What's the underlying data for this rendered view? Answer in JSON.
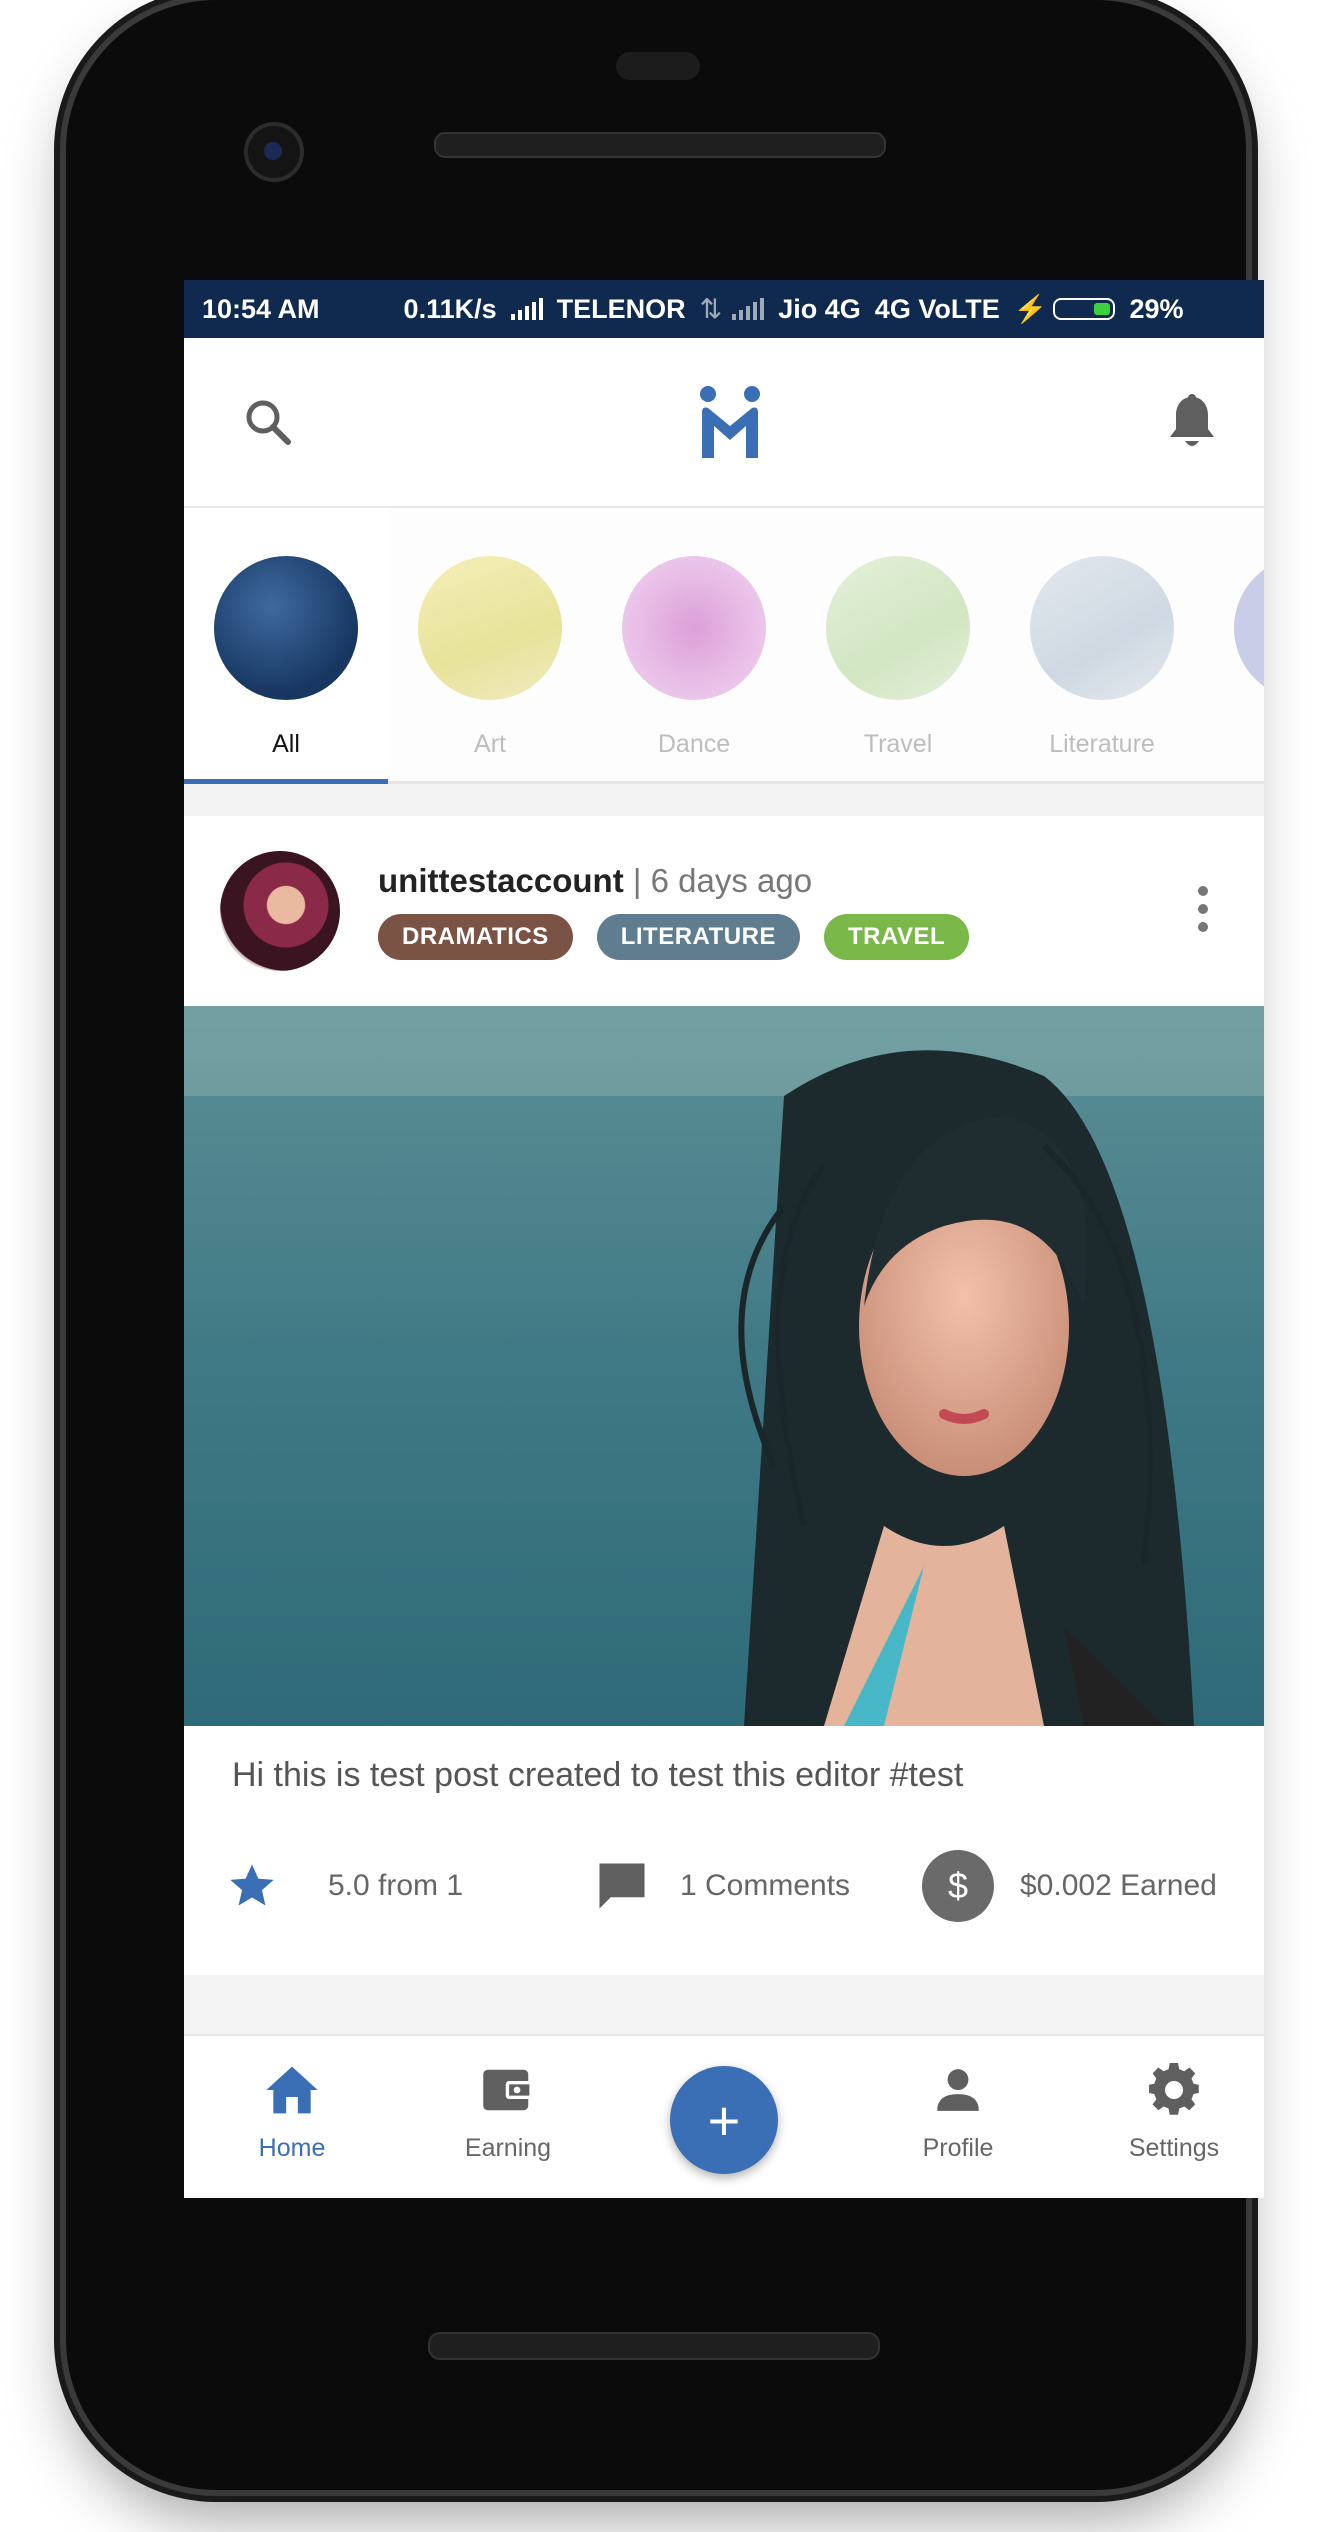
{
  "status_bar": {
    "time": "10:54 AM",
    "speed": "0.11K/s",
    "carrier1": "TELENOR",
    "carrier2": "Jio 4G",
    "network": "4G VoLTE",
    "battery": "29%"
  },
  "app_bar": {
    "search_icon": "search-icon",
    "logo_icon": "logo-icon",
    "bell_icon": "bell-icon",
    "accent": "#3a6fb5"
  },
  "categories": [
    {
      "label": "All",
      "active": true,
      "color": "#1f4a80"
    },
    {
      "label": "Art",
      "active": false,
      "color": "#efe8a8"
    },
    {
      "label": "Dance",
      "active": false,
      "color": "#e7b8e6"
    },
    {
      "label": "Travel",
      "active": false,
      "color": "#d8eacb"
    },
    {
      "label": "Literature",
      "active": false,
      "color": "#d7dee6"
    }
  ],
  "post": {
    "username": "unittestaccount",
    "time": "| 6 days ago",
    "tags": [
      {
        "label": "DRAMATICS",
        "color": "#7b5344"
      },
      {
        "label": "LITERATURE",
        "color": "#5f7d8e"
      },
      {
        "label": "TRAVEL",
        "color": "#7ab84a"
      }
    ],
    "text": "Hi this is test post created to test this editor #test",
    "rating": "5.0 from 1",
    "comments": "1 Comments",
    "earned": "$0.002 Earned",
    "dollar": "$"
  },
  "bottom_nav": {
    "home": "Home",
    "earning": "Earning",
    "add": "+",
    "profile": "Profile",
    "settings": "Settings"
  }
}
